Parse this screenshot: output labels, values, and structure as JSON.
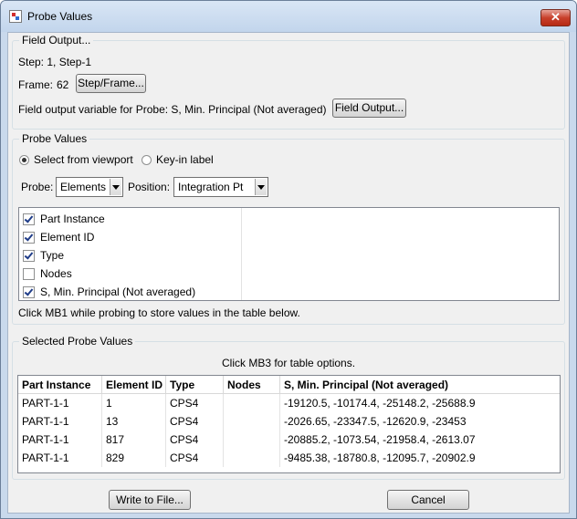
{
  "window": {
    "title": "Probe Values",
    "close_label": "✕"
  },
  "field_output": {
    "legend": "Field Output...",
    "step_text": "Step:  1, Step-1",
    "frame_label": "Frame:",
    "frame_value": "62",
    "step_frame_button": "Step/Frame...",
    "variable_text": "Field output variable for Probe:  S, Min. Principal (Not averaged)",
    "field_output_button": "Field Output..."
  },
  "probe_values": {
    "legend": "Probe Values",
    "radio_viewport": "Select from viewport",
    "radio_keyin": "Key-in label",
    "radio_selected": "viewport",
    "probe_label": "Probe:",
    "probe_value": "Elements",
    "position_label": "Position:",
    "position_value": "Integration Pt",
    "checkbox_items": [
      {
        "label": "Part Instance",
        "checked": true
      },
      {
        "label": "Element ID",
        "checked": true
      },
      {
        "label": "Type",
        "checked": true
      },
      {
        "label": "Nodes",
        "checked": false
      },
      {
        "label": "S, Min. Principal (Not averaged)",
        "checked": true
      }
    ],
    "hint": "Click MB1 while probing to store values in the table below."
  },
  "selected": {
    "legend": "Selected Probe Values",
    "hint": "Click MB3 for table options.",
    "columns": [
      "Part Instance",
      "Element ID",
      "Type",
      "Nodes",
      "S, Min. Principal (Not averaged)"
    ],
    "rows": [
      [
        "PART-1-1",
        "1",
        "CPS4",
        "",
        "-19120.5, -10174.4, -25148.2, -25688.9"
      ],
      [
        "PART-1-1",
        "13",
        "CPS4",
        "",
        "-2026.65, -23347.5, -12620.9, -23453"
      ],
      [
        "PART-1-1",
        "817",
        "CPS4",
        "",
        "-20885.2, -1073.54, -21958.4, -2613.07"
      ],
      [
        "PART-1-1",
        "829",
        "CPS4",
        "",
        "-9485.38, -18780.8, -12095.7, -20902.9"
      ]
    ]
  },
  "footer": {
    "write_button": "Write to File...",
    "cancel_button": "Cancel"
  }
}
